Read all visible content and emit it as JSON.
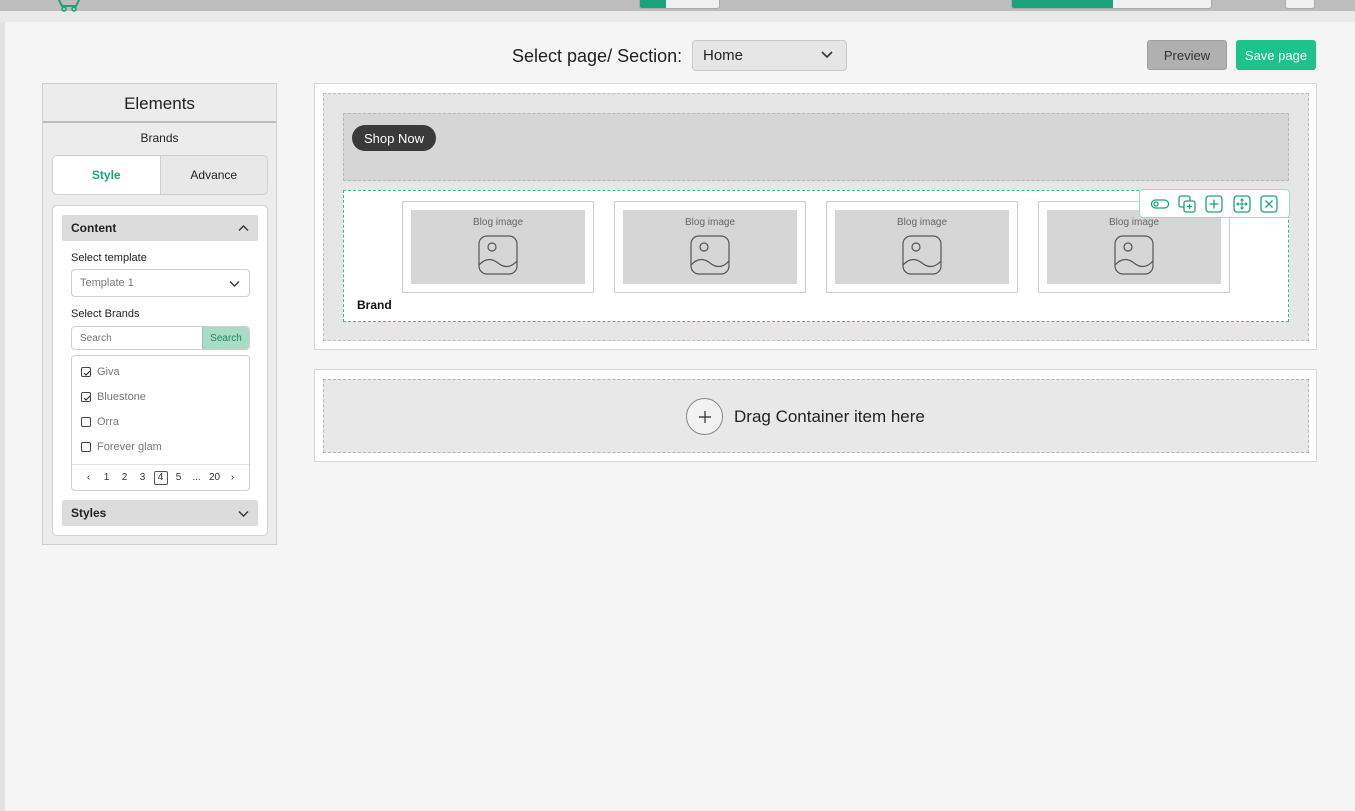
{
  "header": {
    "page_select_label": "Select page/ Section:",
    "page_select_value": "Home",
    "preview_label": "Preview",
    "save_label": "Save page"
  },
  "sidebar": {
    "title": "Elements",
    "subtitle": "Brands",
    "tabs": [
      {
        "label": "Style",
        "active": true
      },
      {
        "label": "Advance",
        "active": false
      }
    ],
    "content_section": {
      "title": "Content",
      "template_label": "Select template",
      "template_value": "Template 1",
      "brands_label": "Select Brands",
      "search_placeholder": "Search",
      "search_button": "Search",
      "brands": [
        {
          "name": "Giva",
          "checked": true
        },
        {
          "name": "Bluestone",
          "checked": true
        },
        {
          "name": "Orra",
          "checked": false
        },
        {
          "name": "Forever glam",
          "checked": false
        }
      ],
      "pagination": {
        "prev": "‹",
        "pages": [
          "1",
          "2",
          "3",
          "4",
          "5",
          "...",
          "20"
        ],
        "current": "4",
        "next": "›"
      }
    },
    "styles_section": {
      "title": "Styles"
    }
  },
  "canvas": {
    "shop_now_label": "Shop Now",
    "brand_label": "Brand",
    "cards": [
      {
        "label": "Blog image"
      },
      {
        "label": "Blog image"
      },
      {
        "label": "Blog image"
      },
      {
        "label": "Blog image"
      }
    ],
    "toolbar_icons": [
      "toggle-icon",
      "duplicate-icon",
      "add-icon",
      "move-icon",
      "close-icon"
    ],
    "drop_zone_text": "Drag Container item here"
  },
  "colors": {
    "accent": "#1ec28b",
    "accent_dark": "#1aa37a",
    "dashed_selection": "#2ec08a"
  }
}
